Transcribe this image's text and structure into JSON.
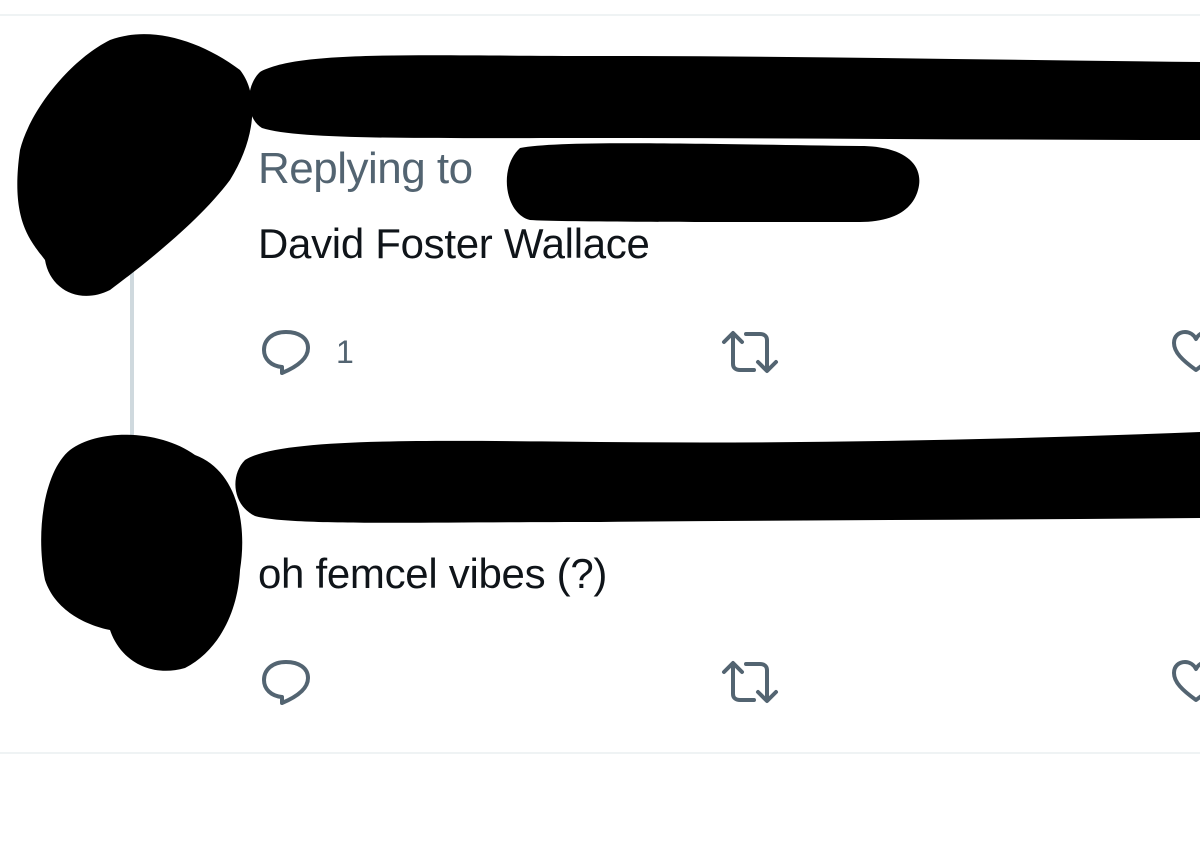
{
  "tweets": [
    {
      "replying_to_prefix": "Replying to",
      "text": "David Foster Wallace",
      "reply_count": "1",
      "icons": [
        "reply-icon",
        "retweet-icon",
        "like-icon"
      ]
    },
    {
      "text": "oh femcel vibes (?)",
      "reply_count": "",
      "icons": [
        "reply-icon",
        "retweet-icon",
        "like-icon"
      ]
    }
  ],
  "colors": {
    "text_primary": "#0f1419",
    "text_secondary": "#536471",
    "divider": "#eff3f4",
    "thread_line": "#cfd9de",
    "redaction": "#000000"
  }
}
